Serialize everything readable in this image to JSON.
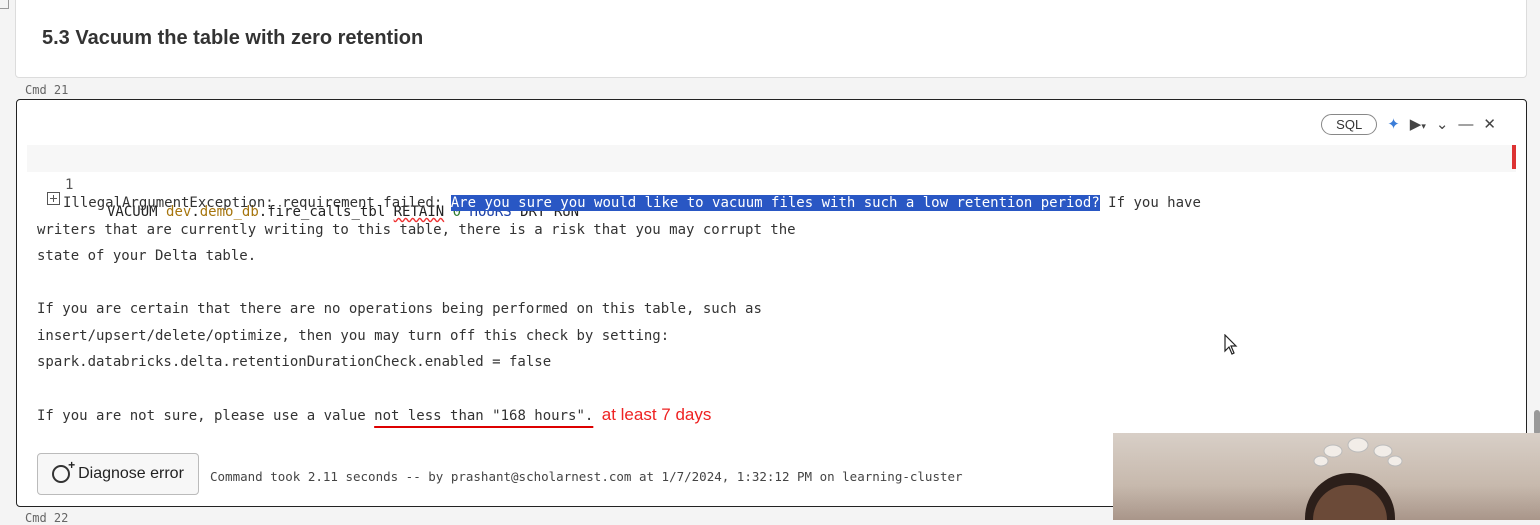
{
  "markdown_cell": {
    "title": "5.3 Vacuum the table with zero retention"
  },
  "cell": {
    "cmd_label": "Cmd 21",
    "language": "SQL",
    "line_number": "1",
    "code": {
      "t1": "VACUUM ",
      "t2": "dev",
      "t3": ".",
      "t4": "demo_db",
      "t5": ".fire_calls_tbl ",
      "t6": "RETAIN",
      "t7": " ",
      "t8": "0",
      "t9": " ",
      "t10": "HOURS",
      "t11": " DRY RUN"
    },
    "output": {
      "prefix": "IllegalArgumentException: requirement failed: ",
      "highlighted": "Are you sure you would like to vacuum files with such a low retention period?",
      "line1_rest": " If you have",
      "line2": "writers that are currently writing to this table, there is a risk that you may corrupt the",
      "line3": "state of your Delta table.",
      "line4": "If you are certain that there are no operations being performed on this table, such as",
      "line5": "insert/upsert/delete/optimize, then you may turn off this check by setting:",
      "line6": "spark.databricks.delta.retentionDurationCheck.enabled = false",
      "line7_prefix": "If you are not sure, please use a value ",
      "line7_underlined": "not less than \"168 hours\".",
      "annotation": "at least 7 days"
    },
    "diagnose_label": "Diagnose error",
    "status": "Command took 2.11 seconds -- by prashant@scholarnest.com at 1/7/2024, 1:32:12 PM on learning-cluster"
  },
  "next_cmd_label": "Cmd 22",
  "icons": [
    "sparkle-icon",
    "run-icon",
    "dropdown-icon",
    "collapse-icon",
    "close-icon",
    "expand-icon",
    "diagnose-icon",
    "mouse-cursor-icon"
  ],
  "colors": {
    "highlight": "#2957c4",
    "annotation": "#e22222",
    "identifier": "#a6750d",
    "keyword": "#1a3fa6"
  }
}
